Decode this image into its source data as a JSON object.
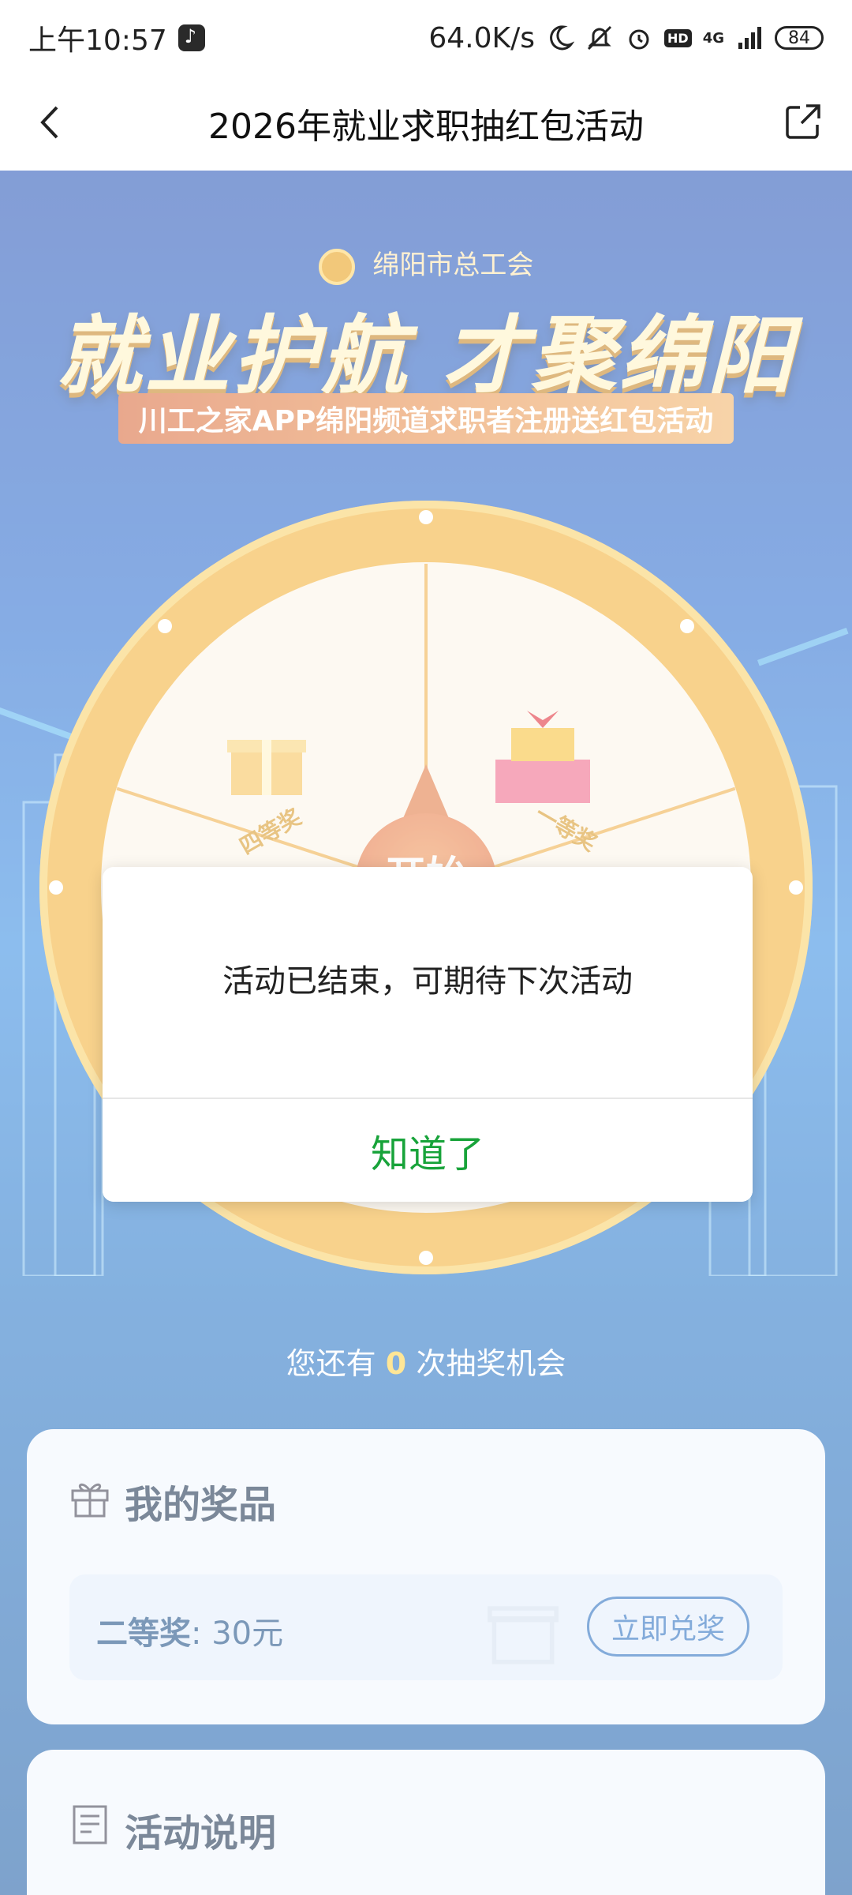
{
  "status_bar": {
    "time": "上午10:57",
    "net_speed": "64.0K/s",
    "network": "4G",
    "battery": "84"
  },
  "nav": {
    "title": "2026年就业求职抽红包活动"
  },
  "banner": {
    "org": "绵阳市总工会",
    "headline": "就业护航 才聚绵阳",
    "subline": "川工之家APP绵阳频道求职者注册送红包活动"
  },
  "wheel": {
    "start_label": "开始",
    "prizes": [
      "四等奖",
      "一等奖"
    ]
  },
  "chances": {
    "prefix": "您还有",
    "count": "0",
    "suffix": "次抽奖机会"
  },
  "my_prizes": {
    "title": "我的奖品",
    "prize_name": "二等奖",
    "prize_value": ": 30元",
    "redeem_label": "立即兑奖"
  },
  "rules": {
    "title": "活动说明"
  },
  "dialog": {
    "message": "活动已结束，可期待下次活动",
    "confirm_label": "知道了",
    "confirm_color": "#18a33a"
  }
}
